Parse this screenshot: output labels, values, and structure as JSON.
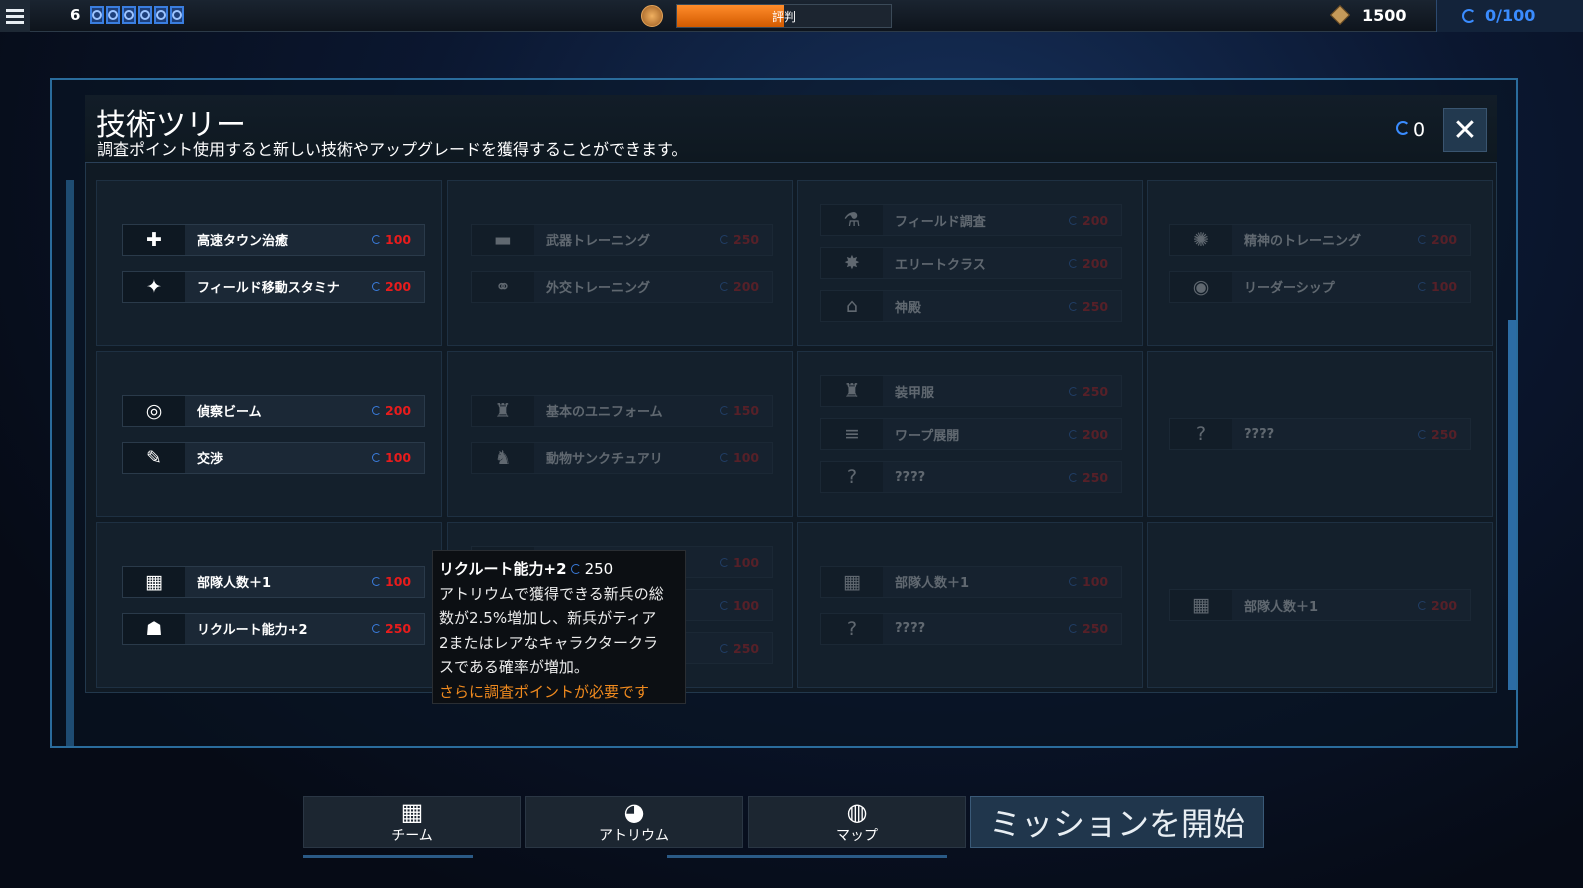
{
  "topbar": {
    "level": "6",
    "pips": 6,
    "reputation_label": "評判",
    "reputation_fill": 0.5,
    "credits": "1500",
    "research_capacity": "0/100"
  },
  "panel": {
    "title": "技術ツリー",
    "subtitle": "調査ポイント使用すると新しい技術やアップグレードを獲得することができます。",
    "research_points": "0",
    "close_icon": "close-icon"
  },
  "rows": [
    {
      "cols": [
        [
          {
            "name": "高速タウン治癒",
            "cost": "100",
            "icon": "heal-icon",
            "locked": false
          },
          {
            "name": "フィールド移動スタミナ",
            "cost": "200",
            "icon": "running-icon",
            "locked": false
          }
        ],
        [
          {
            "name": "武器トレーニング",
            "cost": "250",
            "icon": "weapon-icon",
            "locked": true
          },
          {
            "name": "外交トレーニング",
            "cost": "200",
            "icon": "handshake-icon",
            "locked": true
          }
        ],
        [
          {
            "name": "フィールド調査",
            "cost": "200",
            "icon": "flask-icon",
            "locked": true
          },
          {
            "name": "エリートクラス",
            "cost": "200",
            "icon": "elite-icon",
            "locked": true
          },
          {
            "name": "神殿",
            "cost": "250",
            "icon": "temple-icon",
            "locked": true
          }
        ],
        [
          {
            "name": "精神のトレーニング",
            "cost": "200",
            "icon": "mind-icon",
            "locked": true
          },
          {
            "name": "リーダーシップ",
            "cost": "100",
            "icon": "leadership-icon",
            "locked": true
          }
        ]
      ]
    },
    {
      "cols": [
        [
          {
            "name": "偵察ビーム",
            "cost": "200",
            "icon": "scan-icon",
            "locked": false
          },
          {
            "name": "交渉",
            "cost": "100",
            "icon": "negotiate-icon",
            "locked": false
          }
        ],
        [
          {
            "name": "基本のユニフォーム",
            "cost": "150",
            "icon": "uniform-icon",
            "locked": true
          },
          {
            "name": "動物サンクチュアリ",
            "cost": "100",
            "icon": "animal-icon",
            "locked": true
          }
        ],
        [
          {
            "name": "装甲服",
            "cost": "250",
            "icon": "armor-icon",
            "locked": true
          },
          {
            "name": "ワープ展開",
            "cost": "200",
            "icon": "warp-icon",
            "locked": true
          },
          {
            "name": "????",
            "cost": "250",
            "icon": "question-icon",
            "locked": true
          }
        ],
        [
          {
            "name": "????",
            "cost": "250",
            "icon": "question-icon",
            "locked": true
          }
        ]
      ]
    },
    {
      "cols": [
        [
          {
            "name": "部隊人数＋1",
            "cost": "100",
            "icon": "grid-icon",
            "locked": false
          },
          {
            "name": "リクルート能力+2",
            "cost": "250",
            "icon": "recruit-icon",
            "locked": false
          }
        ],
        [
          {
            "name": "",
            "cost": "100",
            "icon": "",
            "locked": true
          },
          {
            "name": "",
            "cost": "100",
            "icon": "",
            "locked": true
          },
          {
            "name": "",
            "cost": "250",
            "icon": "",
            "locked": true
          }
        ],
        [
          {
            "name": "部隊人数＋1",
            "cost": "100",
            "icon": "grid-icon",
            "locked": true
          },
          {
            "name": "????",
            "cost": "250",
            "icon": "question-icon",
            "locked": true
          }
        ],
        [
          {
            "name": "部隊人数＋1",
            "cost": "200",
            "icon": "grid-icon",
            "locked": true
          }
        ]
      ]
    }
  ],
  "tooltip": {
    "title": "リクルート能力+2",
    "cost": "250",
    "lines": [
      "アトリウムで獲得できる新兵の総",
      "数が2.5%増加し、新兵がティア",
      "2またはレアなキャラクタークラ",
      "スである確率が増加。"
    ],
    "warning": "さらに調査ポイントが必要です"
  },
  "nav": {
    "team": "チーム",
    "atrium": "アトリウム",
    "map": "マップ",
    "start_mission": "ミッションを開始"
  }
}
